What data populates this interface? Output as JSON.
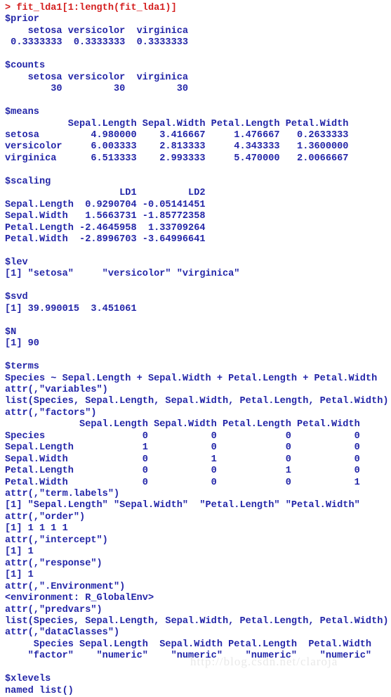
{
  "console": {
    "prompt_symbol": ">",
    "command": "> fit_lda1[1:length(fit_lda1)]",
    "lines": [
      {
        "text": "> fit_lda1[1:length(fit_lda1)]",
        "kind": "prompt"
      },
      {
        "text": "$prior",
        "kind": "output"
      },
      {
        "text": "    setosa versicolor  virginica ",
        "kind": "output"
      },
      {
        "text": " 0.3333333  0.3333333  0.3333333 ",
        "kind": "output"
      },
      {
        "text": "",
        "kind": "blank"
      },
      {
        "text": "$counts",
        "kind": "output"
      },
      {
        "text": "    setosa versicolor  virginica ",
        "kind": "output"
      },
      {
        "text": "        30         30         30 ",
        "kind": "output"
      },
      {
        "text": "",
        "kind": "blank"
      },
      {
        "text": "$means",
        "kind": "output"
      },
      {
        "text": "           Sepal.Length Sepal.Width Petal.Length Petal.Width",
        "kind": "output"
      },
      {
        "text": "setosa         4.980000    3.416667     1.476667   0.2633333",
        "kind": "output"
      },
      {
        "text": "versicolor     6.003333    2.813333     4.343333   1.3600000",
        "kind": "output"
      },
      {
        "text": "virginica      6.513333    2.993333     5.470000   2.0066667",
        "kind": "output"
      },
      {
        "text": "",
        "kind": "blank"
      },
      {
        "text": "$scaling",
        "kind": "output"
      },
      {
        "text": "                    LD1         LD2",
        "kind": "output"
      },
      {
        "text": "Sepal.Length  0.9290704 -0.05141451",
        "kind": "output"
      },
      {
        "text": "Sepal.Width   1.5663731 -1.85772358",
        "kind": "output"
      },
      {
        "text": "Petal.Length -2.4645958  1.33709264",
        "kind": "output"
      },
      {
        "text": "Petal.Width  -2.8996703 -3.64996641",
        "kind": "output"
      },
      {
        "text": "",
        "kind": "blank"
      },
      {
        "text": "$lev",
        "kind": "output"
      },
      {
        "text": "[1] \"setosa\"     \"versicolor\" \"virginica\" ",
        "kind": "output"
      },
      {
        "text": "",
        "kind": "blank"
      },
      {
        "text": "$svd",
        "kind": "output"
      },
      {
        "text": "[1] 39.990015  3.451061",
        "kind": "output"
      },
      {
        "text": "",
        "kind": "blank"
      },
      {
        "text": "$N",
        "kind": "output"
      },
      {
        "text": "[1] 90",
        "kind": "output"
      },
      {
        "text": "",
        "kind": "blank"
      },
      {
        "text": "$terms",
        "kind": "output"
      },
      {
        "text": "Species ~ Sepal.Length + Sepal.Width + Petal.Length + Petal.Width",
        "kind": "output"
      },
      {
        "text": "attr(,\"variables\")",
        "kind": "output"
      },
      {
        "text": "list(Species, Sepal.Length, Sepal.Width, Petal.Length, Petal.Width)",
        "kind": "output"
      },
      {
        "text": "attr(,\"factors\")",
        "kind": "output"
      },
      {
        "text": "             Sepal.Length Sepal.Width Petal.Length Petal.Width",
        "kind": "output"
      },
      {
        "text": "Species                 0           0            0           0",
        "kind": "output"
      },
      {
        "text": "Sepal.Length            1           0            0           0",
        "kind": "output"
      },
      {
        "text": "Sepal.Width             0           1            0           0",
        "kind": "output"
      },
      {
        "text": "Petal.Length            0           0            1           0",
        "kind": "output"
      },
      {
        "text": "Petal.Width             0           0            0           1",
        "kind": "output"
      },
      {
        "text": "attr(,\"term.labels\")",
        "kind": "output"
      },
      {
        "text": "[1] \"Sepal.Length\" \"Sepal.Width\"  \"Petal.Length\" \"Petal.Width\" ",
        "kind": "output"
      },
      {
        "text": "attr(,\"order\")",
        "kind": "output"
      },
      {
        "text": "[1] 1 1 1 1",
        "kind": "output"
      },
      {
        "text": "attr(,\"intercept\")",
        "kind": "output"
      },
      {
        "text": "[1] 1",
        "kind": "output"
      },
      {
        "text": "attr(,\"response\")",
        "kind": "output"
      },
      {
        "text": "[1] 1",
        "kind": "output"
      },
      {
        "text": "attr(,\".Environment\")",
        "kind": "output"
      },
      {
        "text": "<environment: R_GlobalEnv>",
        "kind": "output"
      },
      {
        "text": "attr(,\"predvars\")",
        "kind": "output"
      },
      {
        "text": "list(Species, Sepal.Length, Sepal.Width, Petal.Length, Petal.Width)",
        "kind": "output"
      },
      {
        "text": "attr(,\"dataClasses\")",
        "kind": "output"
      },
      {
        "text": "     Species Sepal.Length  Sepal.Width Petal.Length  Petal.Width ",
        "kind": "output"
      },
      {
        "text": "    \"factor\"    \"numeric\"    \"numeric\"    \"numeric\"    \"numeric\" ",
        "kind": "output"
      },
      {
        "text": "",
        "kind": "blank"
      },
      {
        "text": "$xlevels",
        "kind": "output"
      },
      {
        "text": "named list()",
        "kind": "output"
      }
    ]
  },
  "sections": {
    "prior": {
      "name": "$prior",
      "headers": [
        "setosa",
        "versicolor",
        "virginica"
      ],
      "values": [
        "0.3333333",
        "0.3333333",
        "0.3333333"
      ]
    },
    "counts": {
      "name": "$counts",
      "headers": [
        "setosa",
        "versicolor",
        "virginica"
      ],
      "values": [
        "30",
        "30",
        "30"
      ]
    },
    "means": {
      "name": "$means",
      "columns": [
        "Sepal.Length",
        "Sepal.Width",
        "Petal.Length",
        "Petal.Width"
      ],
      "rows": [
        {
          "label": "setosa",
          "values": [
            "4.980000",
            "3.416667",
            "1.476667",
            "0.2633333"
          ]
        },
        {
          "label": "versicolor",
          "values": [
            "6.003333",
            "2.813333",
            "4.343333",
            "1.3600000"
          ]
        },
        {
          "label": "virginica",
          "values": [
            "6.513333",
            "2.993333",
            "5.470000",
            "2.0066667"
          ]
        }
      ]
    },
    "scaling": {
      "name": "$scaling",
      "columns": [
        "LD1",
        "LD2"
      ],
      "rows": [
        {
          "label": "Sepal.Length",
          "values": [
            "0.9290704",
            "-0.05141451"
          ]
        },
        {
          "label": "Sepal.Width",
          "values": [
            "1.5663731",
            "-1.85772358"
          ]
        },
        {
          "label": "Petal.Length",
          "values": [
            "-2.4645958",
            "1.33709264"
          ]
        },
        {
          "label": "Petal.Width",
          "values": [
            "-2.8996703",
            "-3.64996641"
          ]
        }
      ]
    },
    "lev": {
      "name": "$lev",
      "index": "[1]",
      "values": [
        "\"setosa\"",
        "\"versicolor\"",
        "\"virginica\""
      ]
    },
    "svd": {
      "name": "$svd",
      "index": "[1]",
      "values": [
        "39.990015",
        "3.451061"
      ]
    },
    "n": {
      "name": "$N",
      "index": "[1]",
      "values": [
        "90"
      ]
    },
    "terms": {
      "name": "$terms",
      "formula": "Species ~ Sepal.Length + Sepal.Width + Petal.Length + Petal.Width",
      "variables_attr": "attr(,\"variables\")",
      "variables_value": "list(Species, Sepal.Length, Sepal.Width, Petal.Length, Petal.Width)",
      "factors_attr": "attr(,\"factors\")",
      "factors_columns": [
        "Sepal.Length",
        "Sepal.Width",
        "Petal.Length",
        "Petal.Width"
      ],
      "factors_rows": [
        {
          "label": "Species",
          "values": [
            "0",
            "0",
            "0",
            "0"
          ]
        },
        {
          "label": "Sepal.Length",
          "values": [
            "1",
            "0",
            "0",
            "0"
          ]
        },
        {
          "label": "Sepal.Width",
          "values": [
            "0",
            "1",
            "0",
            "0"
          ]
        },
        {
          "label": "Petal.Length",
          "values": [
            "0",
            "0",
            "1",
            "0"
          ]
        },
        {
          "label": "Petal.Width",
          "values": [
            "0",
            "0",
            "0",
            "1"
          ]
        }
      ],
      "term_labels_attr": "attr(,\"term.labels\")",
      "term_labels_value": "[1] \"Sepal.Length\" \"Sepal.Width\"  \"Petal.Length\" \"Petal.Width\"",
      "order_attr": "attr(,\"order\")",
      "order_value": "[1] 1 1 1 1",
      "intercept_attr": "attr(,\"intercept\")",
      "intercept_value": "[1] 1",
      "response_attr": "attr(,\"response\")",
      "response_value": "[1] 1",
      "environment_attr": "attr(,\".Environment\")",
      "environment_value": "<environment: R_GlobalEnv>",
      "predvars_attr": "attr(,\"predvars\")",
      "predvars_value": "list(Species, Sepal.Length, Sepal.Width, Petal.Length, Petal.Width)",
      "dataclasses_attr": "attr(,\"dataClasses\")",
      "dataclasses_columns": [
        "Species",
        "Sepal.Length",
        "Sepal.Width",
        "Petal.Length",
        "Petal.Width"
      ],
      "dataclasses_values": [
        "\"factor\"",
        "\"numeric\"",
        "\"numeric\"",
        "\"numeric\"",
        "\"numeric\""
      ]
    },
    "xlevels": {
      "name": "$xlevels",
      "value": "named list()"
    }
  },
  "watermark": {
    "text": "http://blog.csdn.net/claroja"
  },
  "colors": {
    "background": "#ffffff",
    "prompt": "#d42020",
    "output": "#2326a8",
    "watermark": "#e9e9e9"
  }
}
